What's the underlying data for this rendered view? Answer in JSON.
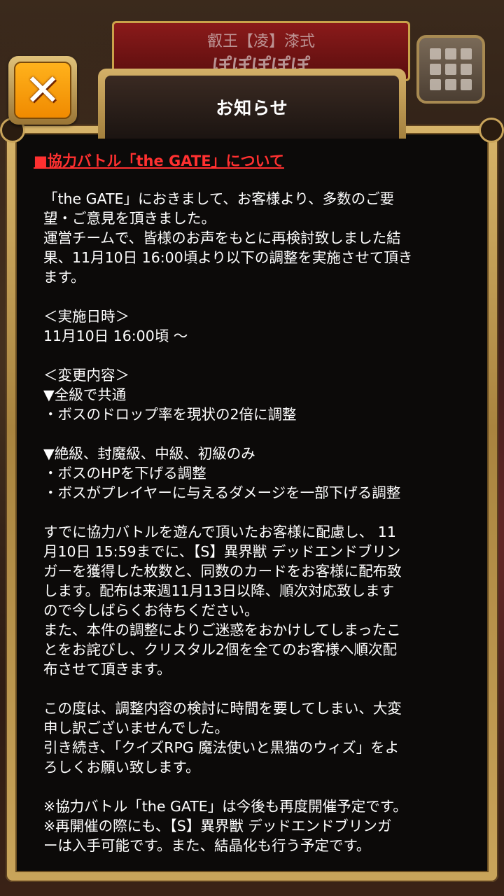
{
  "background": {
    "header_line1": "叡王【凌】漆式",
    "header_line2": "ぽぽぽぽぽ"
  },
  "dialog": {
    "title": "お知らせ",
    "close_label": "✕",
    "heading": "■協力バトル「the GATE」について",
    "paragraphs": [
      "「the GATE」におきまして、お客様より、多数のご要\n望・ご意見を頂きました。\n運営チームで、皆様のお声をもとに再検討致しました結\n果、11月10日 16:00頃より以下の調整を実施させて頂き\nます。",
      "＜実施日時＞\n11月10日 16:00頃 〜",
      "＜変更内容＞\n▼全級で共通\n・ボスのドロップ率を現状の2倍に調整",
      "▼絶級、封魔級、中級、初級のみ\n・ボスのHPを下げる調整\n・ボスがプレイヤーに与えるダメージを一部下げる調整",
      "すでに協力バトルを遊んで頂いたお客様に配慮し、 11\n月10日 15:59までに、【S】異界獣 デッドエンドブリン\nガーを獲得した枚数と、同数のカードをお客様に配布致\nします。配布は来週11月13日以降、順次対応致します\nので今しばらくお待ちください。\nまた、本件の調整によりご迷惑をおかけしてしまったこ\nとをお詫びし、クリスタル2個を全てのお客様へ順次配\n布させて頂きます。",
      "この度は、調整内容の検討に時間を要してしまい、大変\n申し訳ございませんでした。\n引き続き、「クイズRPG 魔法使いと黒猫のウィズ」をよ\nろしくお願い致します。",
      "※協力バトル「the GATE」は今後も再度開催予定です。\n※再開催の際にも、【S】異界獣 デッドエンドブリンガ\nーは入手可能です。また、結晶化も行う予定です。"
    ]
  },
  "colors": {
    "heading": "#ff3030",
    "body_text": "#ffffff",
    "panel_bg": "#0c0a09",
    "frame_gold": "#c9a45a",
    "close_orange": "#f08a00"
  }
}
